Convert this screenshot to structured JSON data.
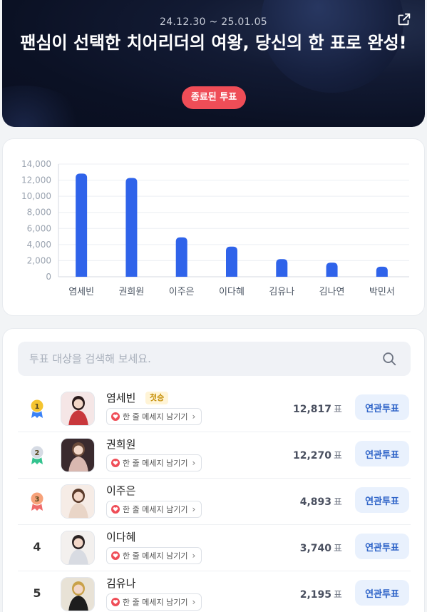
{
  "hero": {
    "period": "24.12.30 ~ 25.01.05",
    "title": "팬심이 선택한 치어리더의 여왕, 당신의 한 표로 완성!",
    "status_badge": "종료된 투표",
    "share_icon": "share-external-icon"
  },
  "chart_data": {
    "type": "bar",
    "categories": [
      "염세빈",
      "권희원",
      "이주은",
      "이다혜",
      "김유나",
      "김나연",
      "박민서"
    ],
    "values": [
      12817,
      12270,
      4893,
      3740,
      2195,
      1750,
      1250
    ],
    "yticks": [
      "0",
      "2,000",
      "4,000",
      "6,000",
      "8,000",
      "10,000",
      "12,000",
      "14,000"
    ],
    "ylim": [
      0,
      14000
    ],
    "grid": true,
    "bar_color": "#2f63ea"
  },
  "search": {
    "placeholder": "투표 대상을 검색해 보세요.",
    "icon": "search-icon"
  },
  "list": {
    "unit": "표",
    "message_label": "한 줄 메세지 남기기",
    "vote_label": "연관투표",
    "first_tag": "첫승",
    "items": [
      {
        "rank": "1",
        "name": "염세빈",
        "votes": "12,817",
        "medal_color": "#f4c430",
        "ribbon_color": "#3b82f6"
      },
      {
        "rank": "2",
        "name": "권희원",
        "votes": "12,270",
        "medal_color": "#d6dbe4",
        "ribbon_color": "#34c38f"
      },
      {
        "rank": "3",
        "name": "이주은",
        "votes": "4,893",
        "medal_color": "#f7a27a",
        "ribbon_color": "#ef6b6b"
      },
      {
        "rank": "4",
        "name": "이다혜",
        "votes": "3,740"
      },
      {
        "rank": "5",
        "name": "김유나",
        "votes": "2,195"
      }
    ]
  }
}
